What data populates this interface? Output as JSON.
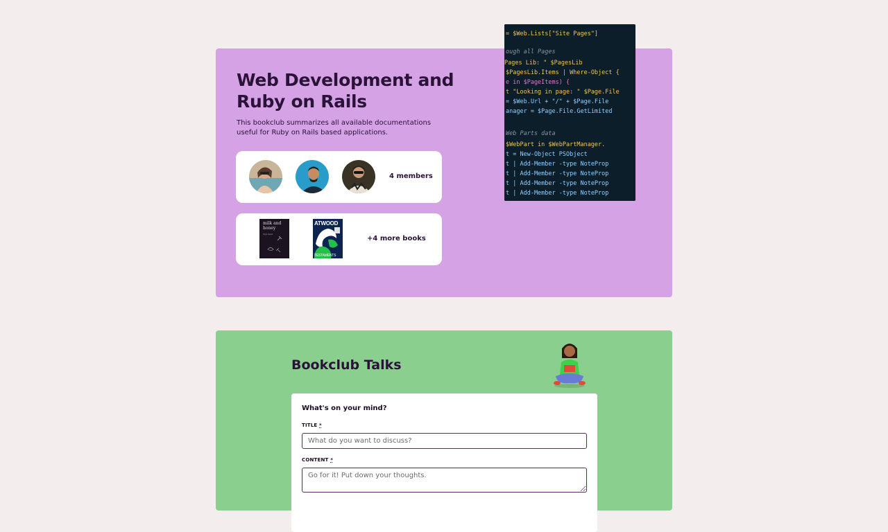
{
  "hero": {
    "title": "Web Development and Ruby on Rails",
    "description": "This bookclub summarizes all available documentations useful for Ruby on Rails based applications.",
    "members_label": "4 members",
    "books_label": "+4 more books",
    "books": [
      {
        "cover_title": "milk and honey",
        "cover_author": "rupi kaur"
      },
      {
        "cover_title": "TESTAMENTS",
        "cover_author": "ATWOOD"
      }
    ]
  },
  "talks": {
    "title": "Bookclub Talks",
    "form": {
      "heading": "What's on your mind?",
      "title_label": "TITLE",
      "title_placeholder": "What do you want to discuss?",
      "content_label": "CONTENT",
      "content_placeholder": "Go for it! Put down your thoughts.",
      "required_mark": "*"
    }
  },
  "colors": {
    "background": "#f3eded",
    "hero_bg": "#d4a2e5",
    "talks_bg": "#8bcf8f",
    "text_dark": "#2b1238"
  }
}
